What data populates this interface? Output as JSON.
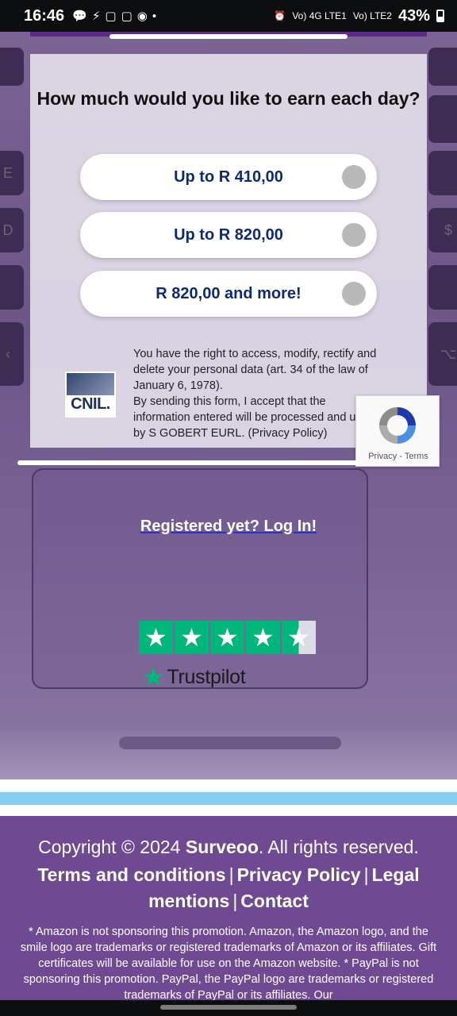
{
  "status_bar": {
    "time": "16:46",
    "battery": "43%",
    "sim1": "Vo) 4G LTE1",
    "sim2": "Vo) LTE2"
  },
  "form": {
    "question": "How much would you like to earn each day?",
    "options": [
      {
        "label": "Up to R 410,00"
      },
      {
        "label": "Up to R 820,00"
      },
      {
        "label": "R 820,00 and more!"
      }
    ],
    "legal_text": "You have the right to access, modify, rectify and delete your personal data (art. 34 of the law of January 6, 1978).\nBy sending this form, I accept that the information entered will be processed and used by S GOBERT EURL. (Privacy Policy)",
    "cnil_logo_text": "CNIL."
  },
  "recaptcha": {
    "links": "Privacy - Terms"
  },
  "login_link": "Registered yet? Log In!",
  "trustpilot": {
    "brand": "Trustpilot",
    "rating": 4.5,
    "max": 5
  },
  "footer": {
    "copyright_prefix": "Copyright © 2024 ",
    "brand": "Surveoo",
    "copyright_suffix": ". All rights reserved.",
    "links": [
      "Terms and conditions",
      "Privacy Policy",
      "Legal mentions",
      "Contact"
    ],
    "disclaimer": "* Amazon is not sponsoring this promotion. Amazon, the Amazon logo, and the smile logo are trademarks or registered trademarks of Amazon or its affiliates. Gift certificates will be available for use on the Amazon website. * PayPal is not sponsoring this promotion. PayPal, the PayPal logo are trademarks or registered trademarks of PayPal or its affiliates. Our"
  },
  "colors": {
    "option_text": "#0d2a78",
    "trustpilot_green": "#00b67a",
    "footer_bg": "#6f4a92",
    "band_blue": "#87cdf0"
  }
}
